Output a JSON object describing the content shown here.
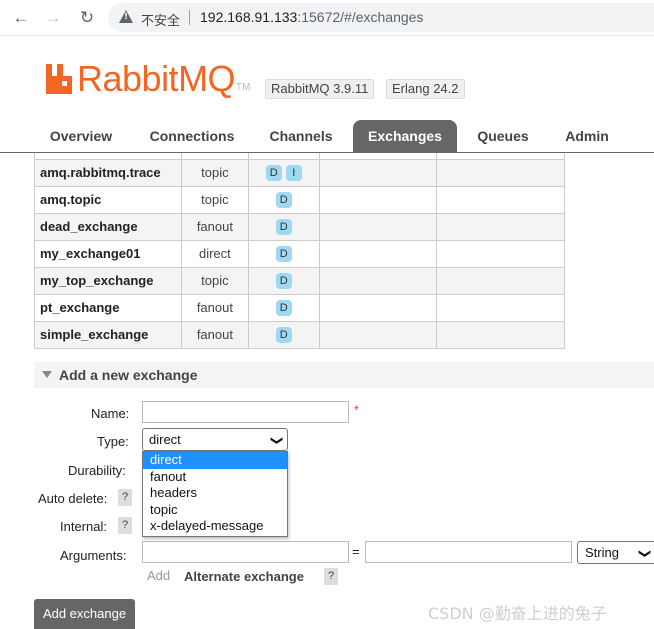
{
  "browser": {
    "back_glyph": "←",
    "forward_glyph": "→",
    "reload_glyph": "↻",
    "security_label": "不安全",
    "url_host": "192.168.91.133",
    "url_rest": ":15672/#/exchanges"
  },
  "header": {
    "logo_text": "RabbitMQ",
    "logo_tm": "TM",
    "brand_color": "#f26522",
    "version_badge": "RabbitMQ 3.9.11",
    "erlang_badge": "Erlang 24.2"
  },
  "tabs": [
    {
      "label": "Overview",
      "active": false
    },
    {
      "label": "Connections",
      "active": false
    },
    {
      "label": "Channels",
      "active": false
    },
    {
      "label": "Exchanges",
      "active": true
    },
    {
      "label": "Queues",
      "active": false
    },
    {
      "label": "Admin",
      "active": false
    }
  ],
  "exchanges": [
    {
      "name": "amq.rabbitmq.trace",
      "type": "topic",
      "features": [
        "D",
        "I"
      ]
    },
    {
      "name": "amq.topic",
      "type": "topic",
      "features": [
        "D"
      ]
    },
    {
      "name": "dead_exchange",
      "type": "fanout",
      "features": [
        "D"
      ]
    },
    {
      "name": "my_exchange01",
      "type": "direct",
      "features": [
        "D"
      ]
    },
    {
      "name": "my_top_exchange",
      "type": "topic",
      "features": [
        "D"
      ]
    },
    {
      "name": "pt_exchange",
      "type": "fanout",
      "features": [
        "D"
      ]
    },
    {
      "name": "simple_exchange",
      "type": "fanout",
      "features": [
        "D"
      ]
    }
  ],
  "add_section": {
    "title": "Add a new exchange",
    "labels": {
      "name": "Name:",
      "type": "Type:",
      "durability": "Durability:",
      "auto_delete": "Auto delete:",
      "internal": "Internal:",
      "arguments": "Arguments:"
    },
    "help_glyph": "?",
    "required_mark": "*",
    "type_selected": "direct",
    "type_options": [
      "direct",
      "fanout",
      "headers",
      "topic",
      "x-delayed-message"
    ],
    "eq_sign": "=",
    "arg_type": "String",
    "add_link": "Add",
    "alternate_exchange": "Alternate exchange",
    "submit_label": "Add exchange"
  },
  "watermark": "CSDN @勤奋上进的兔子"
}
